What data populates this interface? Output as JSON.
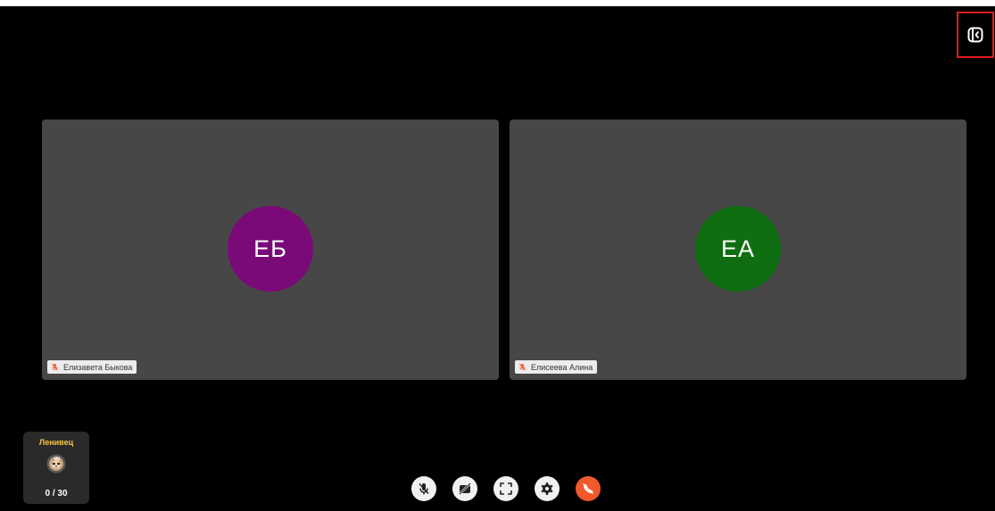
{
  "colors": {
    "background": "#000000",
    "tile": "#474747",
    "highlight_border": "#e11b1b",
    "end_call": "#f1592a",
    "game_title": "#f5c542"
  },
  "participants": [
    {
      "initials": "ЕБ",
      "name": "Елизавета Быкова",
      "avatar_color": "#7a0a78",
      "mic_status_icon": "mic-muted-icon"
    },
    {
      "initials": "ЕА",
      "name": "Елисеева Алина",
      "avatar_color": "#0f6e11",
      "mic_status_icon": "mic-muted-icon"
    }
  ],
  "game_widget": {
    "title": "Ленивец",
    "icon": "sloth-icon",
    "count": "0 / 30"
  },
  "top_right": {
    "icon": "panel-collapse-icon"
  },
  "controls": [
    {
      "name": "mic-toggle-button",
      "icon": "mic-off-icon"
    },
    {
      "name": "camera-toggle-button",
      "icon": "camera-off-icon"
    },
    {
      "name": "fullscreen-button",
      "icon": "fullscreen-icon"
    },
    {
      "name": "settings-button",
      "icon": "gear-icon"
    },
    {
      "name": "end-call-button",
      "icon": "hang-up-icon"
    }
  ]
}
